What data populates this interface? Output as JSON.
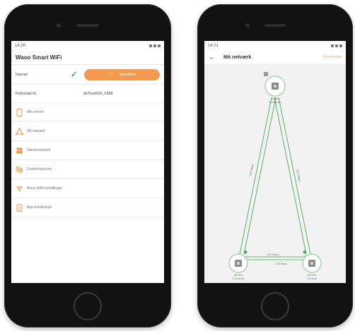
{
  "left_app": {
    "status": {
      "time": "14:20"
    },
    "title": "Waoo Smart WiFi",
    "internet_label": "Internet",
    "speedtest_label": "Speedtest",
    "connection_label": "Forbundet til:",
    "connection_value": "AirTies4920_X3B8",
    "menu": [
      {
        "label": "Min enhed",
        "icon": "phone-icon"
      },
      {
        "label": "Mit netværk",
        "icon": "network-icon"
      },
      {
        "label": "Gæstenetværk",
        "icon": "guests-icon"
      },
      {
        "label": "Forældrekontrol",
        "icon": "parental-icon"
      },
      {
        "label": "Wave WiFi indstillinger",
        "icon": "wifi-icon"
      },
      {
        "label": "App-indstillinger",
        "icon": "settings-icon"
      }
    ]
  },
  "right_app": {
    "status": {
      "time": "14:21"
    },
    "title": "Mit netværk",
    "action": "Vis enheder",
    "nodes": [
      {
        "name": "AirTies",
        "sub": "4 enheder"
      },
      {
        "name": "AirTies",
        "sub": "2 enheder"
      },
      {
        "name": "AirTies",
        "sub": "1 enhed"
      }
    ],
    "link_labels": [
      "130 Mbps",
      "130 Mbps",
      "130 Mbps",
      "125 Mbps"
    ]
  },
  "colors": {
    "accent": "#f39a4e",
    "check": "#34a34a",
    "link": "#34a34a",
    "node_ring": "#9bcf9b",
    "phone_body": "#121212"
  }
}
